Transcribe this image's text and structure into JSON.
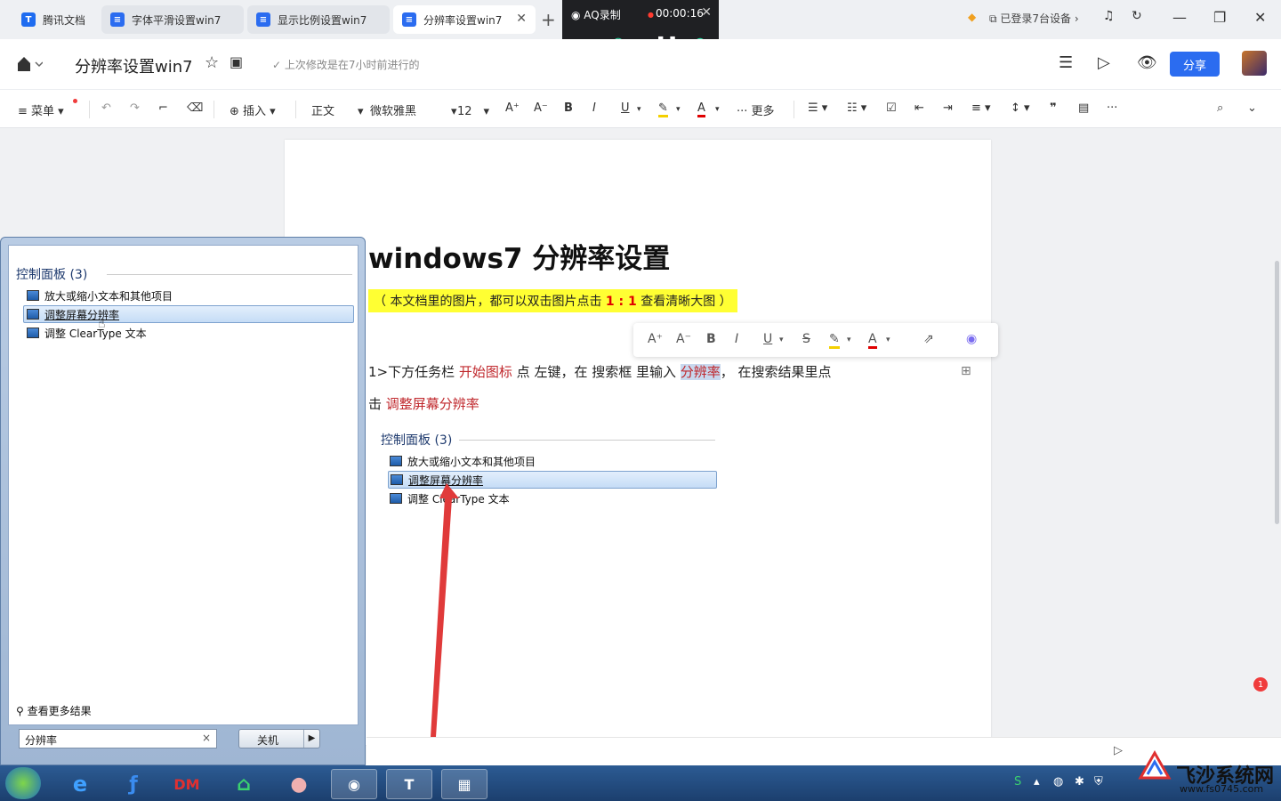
{
  "tabs": [
    {
      "label": "腾讯文档",
      "icon": "tencent-docs-logo-icon"
    },
    {
      "label": "字体平滑设置win7",
      "icon": "doc-icon"
    },
    {
      "label": "显示比例设置win7",
      "icon": "doc-icon"
    },
    {
      "label": "分辨率设置win7",
      "icon": "doc-icon"
    }
  ],
  "topright": {
    "devices": "已登录7台设备",
    "devices_chevron": "›"
  },
  "recorder": {
    "name": "AQ录制",
    "time": "00:00:16"
  },
  "header": {
    "title": "分辨率设置win7",
    "saved": "上次修改是在7小时前进行的",
    "share": "分享"
  },
  "toolbar": {
    "menu": "菜单",
    "insert": "插入",
    "style": "正文",
    "font": "微软雅黑",
    "size": "12",
    "more": "更多",
    "bold": "B",
    "italic": "I",
    "underline": "U",
    "font_color": "A",
    "grow": "A⁺",
    "shrink": "A⁻",
    "ellipsis": "···"
  },
  "floatbar": {
    "bold": "B",
    "italic": "I",
    "underline": "U",
    "strike": "S",
    "color": "A",
    "grow": "A⁺",
    "shrink": "A⁻"
  },
  "doc": {
    "heading": "windows7  分辨率设置",
    "note_prefix": "（ 本文档里的图片，都可以双击图片点击 ",
    "note_bold": "1 : 1",
    "note_suffix": " 查看清晰大图 ）",
    "p1_a": "1>下方任务栏  ",
    "p1_b": "开始图标",
    "p1_c": "   点  左键，在  搜索框  里输入  ",
    "p1_d": "分辨率",
    "p1_e": "，   在搜索结果里点",
    "p2_a": "击  ",
    "p2_b": "调整屏幕分辨率"
  },
  "results": {
    "header": "控制面板 (3)",
    "items": [
      "放大或缩小文本和其他项目",
      "调整屏幕分辨率",
      "调整 ClearType 文本"
    ]
  },
  "embedded": {
    "header": "控制面板 (3)",
    "items": [
      "放大或缩小文本和其他项目",
      "调整屏幕分辨率",
      "调整 ClearType 文本"
    ]
  },
  "startmenu": {
    "more_results": "查看更多结果",
    "search_value": "分辨率",
    "clear": "×",
    "shutdown": "关机"
  },
  "side": {
    "badge": "1"
  },
  "taskbar": {
    "dm": "DM"
  },
  "watermark": {
    "name": "飞沙系统网",
    "url": "www.fs0745.com"
  },
  "colors": {
    "accent": "#2b6cf0",
    "highlight_red": "#c0282d",
    "note_bg": "#ffff33"
  }
}
